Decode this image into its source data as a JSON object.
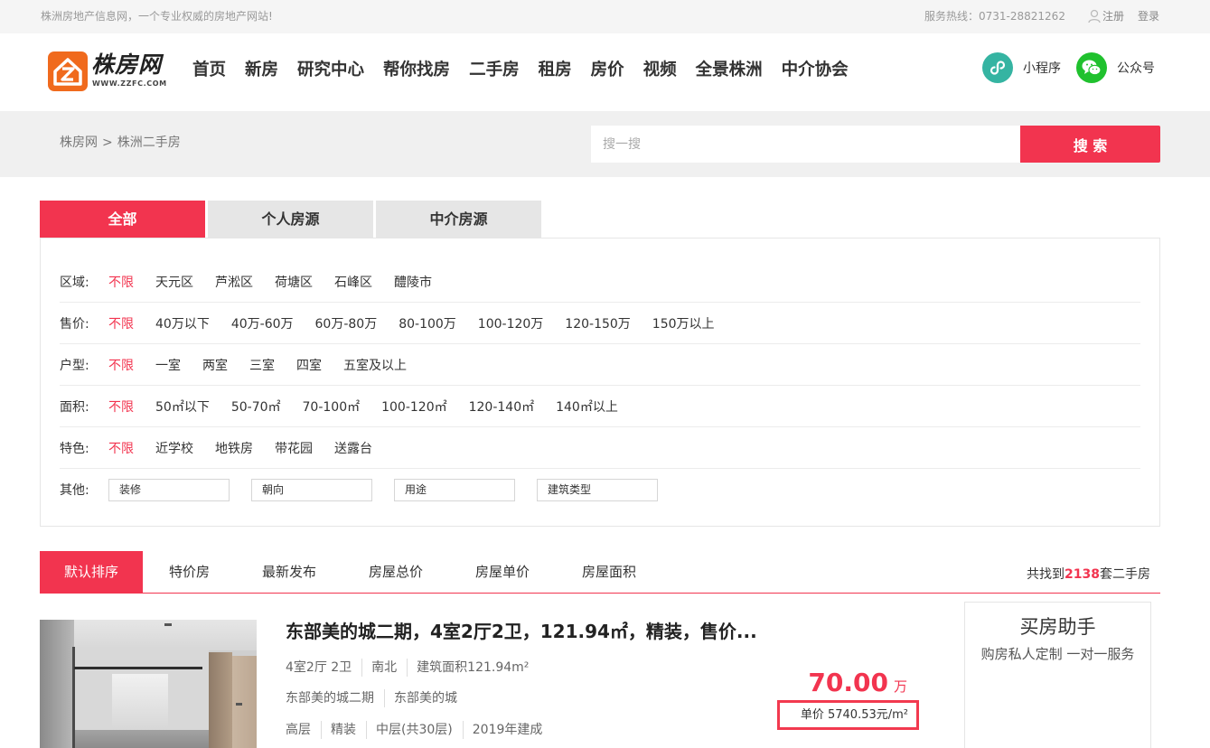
{
  "colors": {
    "accent": "#f2344f",
    "topbar_bg": "#f5f5f5",
    "search_band_bg": "#f0f0f0",
    "inactive_tab_bg": "#e6e6e6",
    "logo_orange": "#f06a1d",
    "mini_program_teal": "#35b4a2",
    "wechat_green": "#20c12e"
  },
  "topbar": {
    "slogan": "株洲房地产信息网，一个专业权威的房地产网站!",
    "hotline": "服务热线：0731-28821262",
    "user_icon": "user-icon",
    "register": "注册",
    "login": "登录"
  },
  "header": {
    "logo": {
      "icon": "house-z-logo",
      "name": "株房网",
      "domain": "WWW.ZZFC.COM"
    },
    "nav": [
      "首页",
      "新房",
      "研究中心",
      "帮你找房",
      "二手房",
      "租房",
      "房价",
      "视频",
      "全景株洲",
      "中介协会"
    ],
    "mini_program": {
      "icon": "mini-program-icon",
      "label": "小程序"
    },
    "official_account": {
      "icon": "wechat-icon",
      "label": "公众号"
    }
  },
  "search": {
    "breadcrumb": [
      "株房网",
      "株洲二手房"
    ],
    "breadcrumb_separator": ">",
    "placeholder": "搜一搜",
    "value": "",
    "button": "搜 索"
  },
  "source_tabs": [
    {
      "label": "全部",
      "active": true
    },
    {
      "label": "个人房源",
      "active": false
    },
    {
      "label": "中介房源",
      "active": false
    }
  ],
  "filters": [
    {
      "label": "区域:",
      "selected_index": 0,
      "options": [
        "不限",
        "天元区",
        "芦淞区",
        "荷塘区",
        "石峰区",
        "醴陵市"
      ]
    },
    {
      "label": "售价:",
      "selected_index": 0,
      "options": [
        "不限",
        "40万以下",
        "40万-60万",
        "60万-80万",
        "80-100万",
        "100-120万",
        "120-150万",
        "150万以上"
      ]
    },
    {
      "label": "户型:",
      "selected_index": 0,
      "options": [
        "不限",
        "一室",
        "两室",
        "三室",
        "四室",
        "五室及以上"
      ]
    },
    {
      "label": "面积:",
      "selected_index": 0,
      "options": [
        "不限",
        "50㎡以下",
        "50-70㎡",
        "70-100㎡",
        "100-120㎡",
        "120-140㎡",
        "140㎡以上"
      ]
    },
    {
      "label": "特色:",
      "selected_index": 0,
      "options": [
        "不限",
        "近学校",
        "地铁房",
        "带花园",
        "送露台"
      ]
    }
  ],
  "other_filters": {
    "label": "其他:",
    "selects": [
      "装修",
      "朝向",
      "用途",
      "建筑类型"
    ]
  },
  "sort": {
    "tabs": [
      {
        "label": "默认排序",
        "active": true
      },
      {
        "label": "特价房",
        "active": false
      },
      {
        "label": "最新发布",
        "active": false
      },
      {
        "label": "房屋总价",
        "active": false
      },
      {
        "label": "房屋单价",
        "active": false
      },
      {
        "label": "房屋面积",
        "active": false
      }
    ],
    "result_prefix": "共找到",
    "result_count": "2138",
    "result_suffix": "套二手房"
  },
  "listing": {
    "title": "东部美的城二期，4室2厅2卫，121.94㎡，精装，售价...",
    "details": [
      [
        "4室2厅 2卫",
        "南北",
        "建筑面积121.94m²"
      ],
      [
        "东部美的城二期",
        "东部美的城"
      ],
      [
        "高层",
        "精装",
        "中层(共30层)",
        "2019年建成"
      ]
    ],
    "price": "70.00",
    "price_unit": "万",
    "unit_price_label": "单价",
    "unit_price": "5740.53元/m²"
  },
  "sidebar": {
    "title": "买房助手",
    "subtitle": "购房私人定制 一对一服务"
  }
}
